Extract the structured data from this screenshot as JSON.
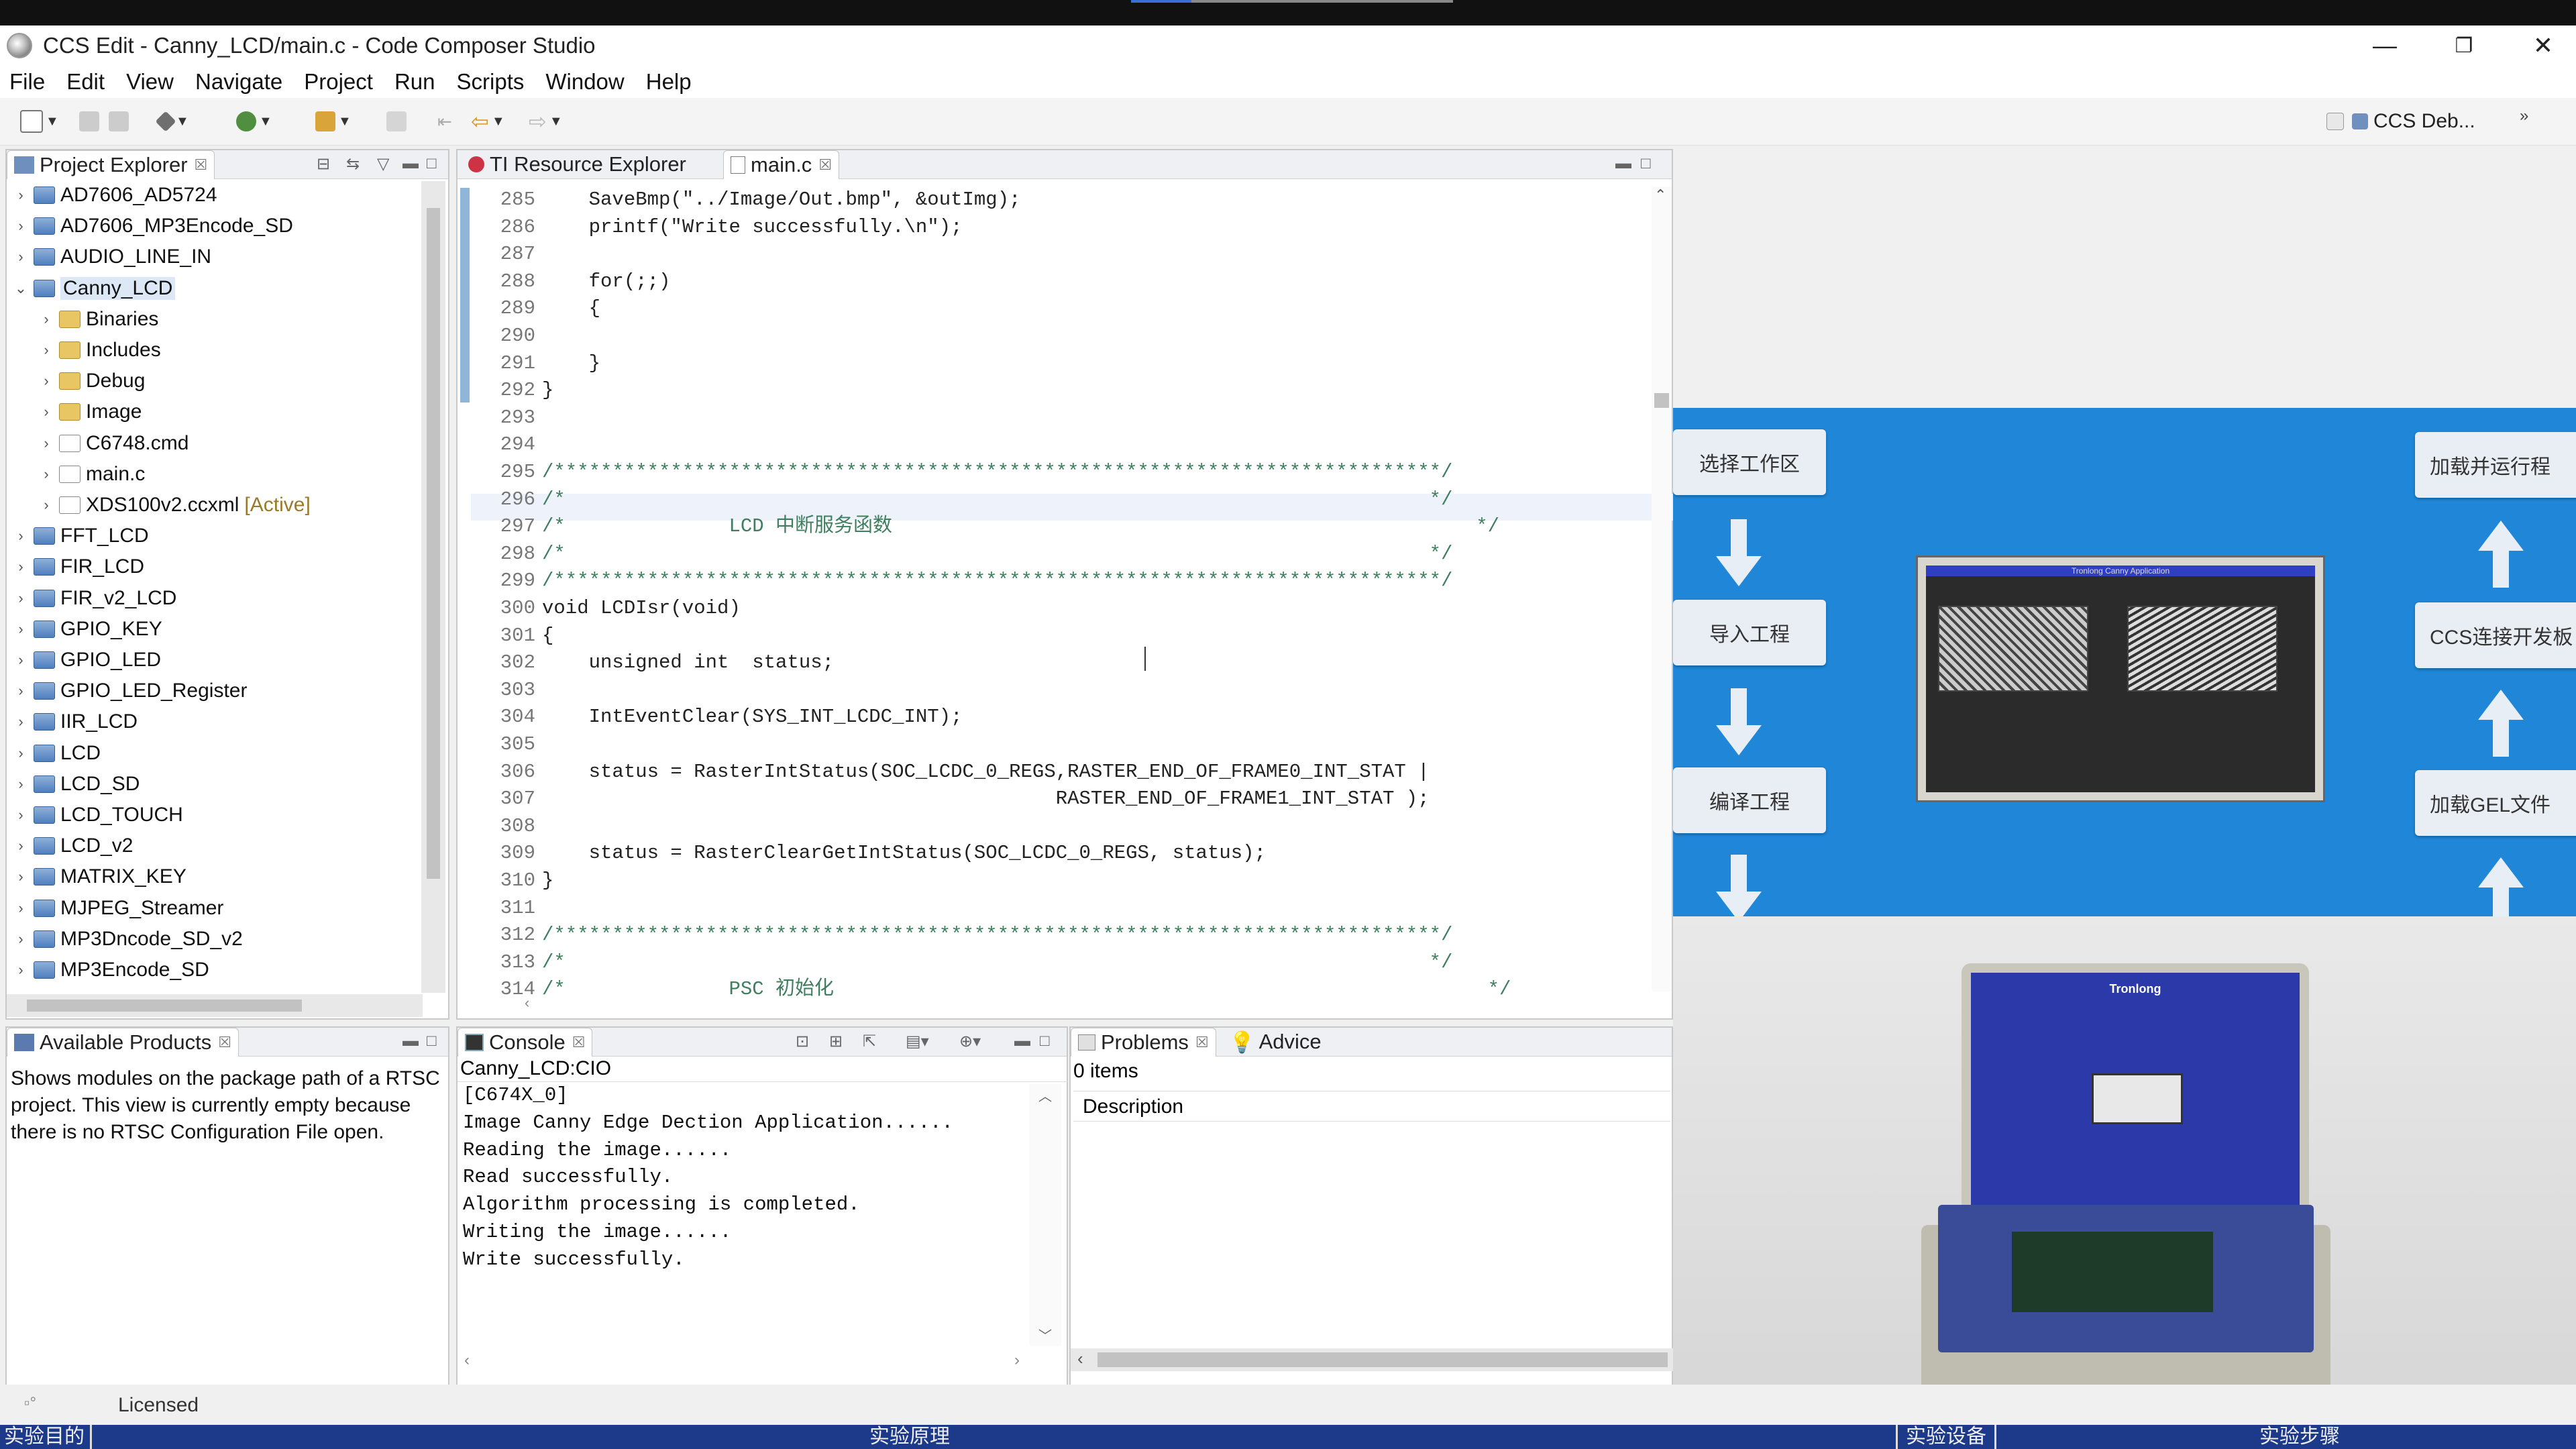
{
  "window": {
    "title": "CCS Edit - Canny_LCD/main.c - Code Composer Studio",
    "controls": [
      "—",
      "❐",
      "✕"
    ]
  },
  "menu": [
    "File",
    "Edit",
    "View",
    "Navigate",
    "Project",
    "Run",
    "Scripts",
    "Window",
    "Help"
  ],
  "toolbar": {
    "perspective_label": "CCS Deb...",
    "overflow": "»"
  },
  "project_explorer": {
    "tab_label": "Project Explorer",
    "items": [
      {
        "label": "AD7606_AD5724",
        "level": 0,
        "expanded": false
      },
      {
        "label": "AD7606_MP3Encode_SD",
        "level": 0,
        "expanded": false
      },
      {
        "label": "AUDIO_LINE_IN",
        "level": 0,
        "expanded": false
      },
      {
        "label": "Canny_LCD",
        "level": 0,
        "expanded": true
      },
      {
        "label": "Binaries",
        "level": 1
      },
      {
        "label": "Includes",
        "level": 1
      },
      {
        "label": "Debug",
        "level": 1
      },
      {
        "label": "Image",
        "level": 1
      },
      {
        "label": "C6748.cmd",
        "level": 1
      },
      {
        "label": "main.c",
        "level": 1
      },
      {
        "label": "XDS100v2.ccxml",
        "level": 1,
        "tag": "[Active]"
      },
      {
        "label": "FFT_LCD",
        "level": 0
      },
      {
        "label": "FIR_LCD",
        "level": 0
      },
      {
        "label": "FIR_v2_LCD",
        "level": 0
      },
      {
        "label": "GPIO_KEY",
        "level": 0
      },
      {
        "label": "GPIO_LED",
        "level": 0
      },
      {
        "label": "GPIO_LED_Register",
        "level": 0
      },
      {
        "label": "IIR_LCD",
        "level": 0
      },
      {
        "label": "LCD",
        "level": 0
      },
      {
        "label": "LCD_SD",
        "level": 0
      },
      {
        "label": "LCD_TOUCH",
        "level": 0
      },
      {
        "label": "LCD_v2",
        "level": 0
      },
      {
        "label": "MATRIX_KEY",
        "level": 0
      },
      {
        "label": "MJPEG_Streamer",
        "level": 0
      },
      {
        "label": "MP3Dncode_SD_v2",
        "level": 0
      },
      {
        "label": "MP3Encode_SD",
        "level": 0
      }
    ]
  },
  "editor": {
    "tabs": [
      {
        "label": "TI Resource Explorer",
        "active": false
      },
      {
        "label": "main.c",
        "active": true
      }
    ],
    "lines": [
      {
        "n": "285",
        "t": "    SaveBmp(\"../Image/Out.bmp\", &outImg);"
      },
      {
        "n": "286",
        "t": "    printf(\"Write successfully.\\n\");"
      },
      {
        "n": "287",
        "t": ""
      },
      {
        "n": "288",
        "t": "    for(;;)"
      },
      {
        "n": "289",
        "t": "    {"
      },
      {
        "n": "290",
        "t": ""
      },
      {
        "n": "291",
        "t": "    }"
      },
      {
        "n": "292",
        "t": "}"
      },
      {
        "n": "293",
        "t": ""
      },
      {
        "n": "294",
        "t": ""
      },
      {
        "n": "295",
        "t": "/****************************************************************************/"
      },
      {
        "n": "296",
        "t": "/*                                                                          */"
      },
      {
        "n": "297",
        "t": "/*              LCD 中断服务函数                                                  */"
      },
      {
        "n": "298",
        "t": "/*                                                                          */"
      },
      {
        "n": "299",
        "t": "/****************************************************************************/"
      },
      {
        "n": "300",
        "t": "void LCDIsr(void)"
      },
      {
        "n": "301",
        "t": "{"
      },
      {
        "n": "302",
        "t": "    unsigned int  status;"
      },
      {
        "n": "303",
        "t": ""
      },
      {
        "n": "304",
        "t": "    IntEventClear(SYS_INT_LCDC_INT);"
      },
      {
        "n": "305",
        "t": ""
      },
      {
        "n": "306",
        "t": "    status = RasterIntStatus(SOC_LCDC_0_REGS,RASTER_END_OF_FRAME0_INT_STAT |"
      },
      {
        "n": "307",
        "t": "                                            RASTER_END_OF_FRAME1_INT_STAT );"
      },
      {
        "n": "308",
        "t": ""
      },
      {
        "n": "309",
        "t": "    status = RasterClearGetIntStatus(SOC_LCDC_0_REGS, status);"
      },
      {
        "n": "310",
        "t": "}"
      },
      {
        "n": "311",
        "t": ""
      },
      {
        "n": "312",
        "t": "/****************************************************************************/"
      },
      {
        "n": "313",
        "t": "/*                                                                          */"
      },
      {
        "n": "314",
        "t": "/*              PSC 初始化                                                        */"
      }
    ]
  },
  "available_products": {
    "tab_label": "Available Products",
    "text": "Shows modules on the package path of a RTSC project. This view is currently empty because there is no RTSC Configuration File open."
  },
  "console": {
    "tab_label": "Console",
    "name": "Canny_LCD:CIO",
    "lines": [
      "[C674X_0]",
      "Image Canny Edge Dection Application......",
      "Reading the image......",
      "Read successfully.",
      "Algorithm processing is completed.",
      "Writing the image......",
      "Write successfully."
    ]
  },
  "problems": {
    "tab_label": "Problems",
    "advice_label": "Advice",
    "count": "0 items",
    "column": "Description"
  },
  "status": {
    "licensed": "Licensed"
  },
  "video_overlay": {
    "left_steps": [
      "选择工作区",
      "导入工程",
      "编译工程"
    ],
    "right_steps": [
      "加载并运行程",
      "CCS连接开发板",
      "加载GEL文件"
    ],
    "screen_caption": "Tronlong Canny Application",
    "case_brand": "Tronlong"
  },
  "bottom_captions": [
    "实验目的",
    "实验原理",
    "实验设备",
    "实验步骤"
  ],
  "colors": {
    "overlay_blue": "#1f86d8",
    "bottom_bar": "#1d3a8a",
    "keyword": "#7f0055",
    "string": "#2a00ff"
  }
}
